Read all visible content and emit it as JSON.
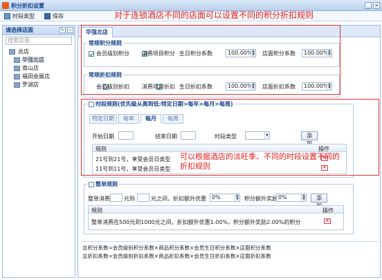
{
  "window": {
    "title": "积分折扣设置",
    "minimize": "_",
    "close": "×"
  },
  "toolbar": {
    "period_type": "时段类型",
    "save": "保存"
  },
  "left": {
    "header": "请选择店面",
    "refresh_icon": "refresh-icon",
    "collapse_icon": "collapse-icon",
    "search_placeholder": "搜索店面",
    "tree": [
      {
        "label": "总店",
        "level": 0
      },
      {
        "label": "华强北店",
        "level": 1,
        "selected": true
      },
      {
        "label": "南山店",
        "level": 1
      },
      {
        "label": "福田会展店",
        "level": 1
      },
      {
        "label": "罗湖店",
        "level": 1
      }
    ]
  },
  "main": {
    "tab": "华强北店",
    "points_rule": {
      "title": "常规积分规则",
      "cb1": "会员级别积分",
      "cb2": "消费项目积分",
      "birthday_label": "生日积分系数",
      "birthday_value": "100.00%",
      "store_label": "店面积分系数",
      "store_value": "100.00%"
    },
    "discount_rule": {
      "title": "常规折扣规则",
      "cb1": "会员级别折扣",
      "cb2": "消费项目折扣",
      "birthday_label": "生日折扣系数",
      "birthday_value": "100.00%",
      "store_label": "店面折扣系数",
      "store_value": "100.00%"
    },
    "period_rule": {
      "title": "时段规则(优先级从高到低:特定日期>每年>每月>每周)",
      "tabs": [
        "特定日期",
        "每年",
        "每月",
        "每周"
      ],
      "active_tab": "每月",
      "start_label": "开始日期",
      "end_label": "结束日期",
      "type_label": "时段类型",
      "add": "添加",
      "col_rule": "规则",
      "col_op": "操作",
      "rows": [
        "21号到21号，享受会员日类型",
        "11号到11号，享受会员日类型"
      ]
    },
    "whole_rule": {
      "title": "整单规则",
      "whole_label": "整单消费",
      "yuan_to": "元到",
      "between": "元之间，折扣额外优惠",
      "disc_value": "0%",
      "points_label": "积分额外奖励",
      "points_value": "0%",
      "add": "添加",
      "col_rule": "规则",
      "col_op": "操作",
      "row": "整单消费在500元到1000元之间，折扣额外优惠1.00%，积分额外奖励2.00%的积分"
    },
    "formula_points": "总积分系数=会员级别积分系数×商品积分系数×会员生日积分系数×店面积分系数",
    "formula_discount": "总折扣系数=会员级别折扣系数×商品折扣系数×会员生日折扣系数×店面折扣系数"
  },
  "annotations": {
    "top": "对于连锁酒店不同的店面可以设置不同的积分折扣规则",
    "period_line1": "可以根据酒店的淡旺季、不同的时段设置不同的",
    "period_line2": "折扣规则"
  },
  "colors": {
    "accent": "#15428b",
    "annotation": "#e02020",
    "panel_border": "#99bbe8"
  }
}
